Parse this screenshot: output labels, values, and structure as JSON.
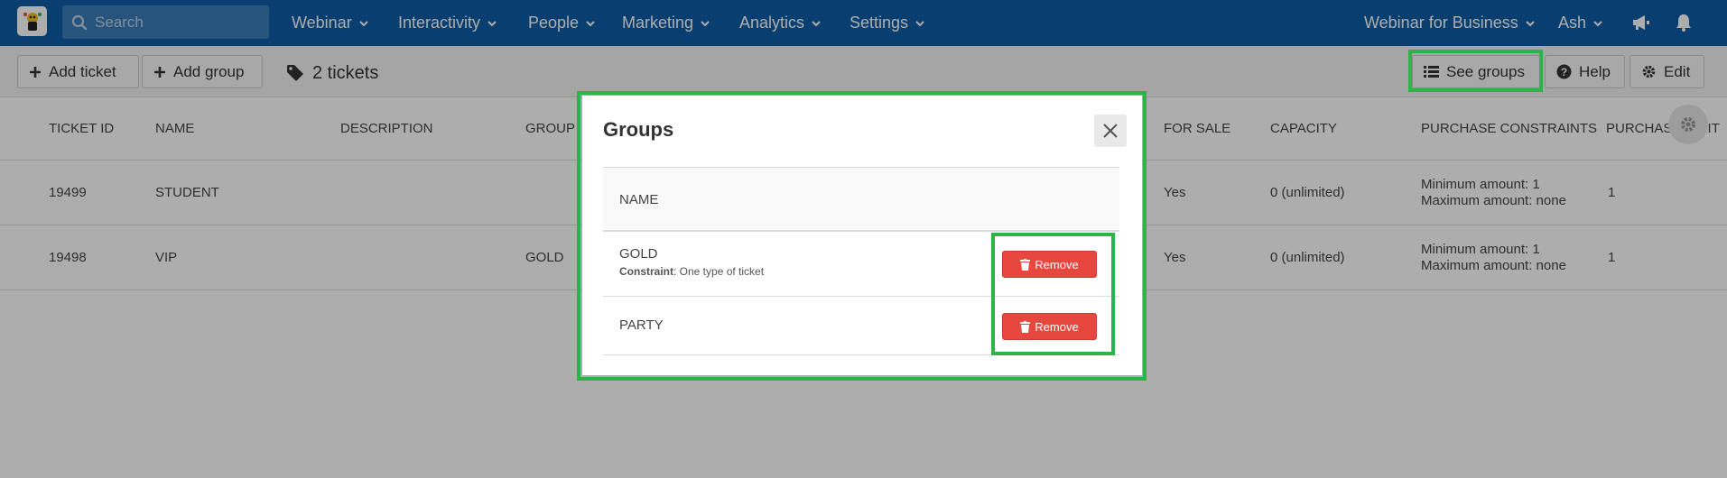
{
  "topnav": {
    "search_placeholder": "Search",
    "menus": [
      "Webinar",
      "Interactivity",
      "People",
      "Marketing",
      "Analytics",
      "Settings"
    ],
    "account": "Webinar for Business",
    "user": "Ash",
    "icons": [
      "megaphone-icon",
      "bell-icon"
    ]
  },
  "toolbar": {
    "add_ticket": "Add ticket",
    "add_group": "Add group",
    "ticket_count": "2 tickets",
    "see_groups": "See groups",
    "help": "Help",
    "edit": "Edit"
  },
  "table": {
    "columns": [
      "TICKET ID",
      "NAME",
      "DESCRIPTION",
      "GROUP",
      "FOR SALE",
      "CAPACITY",
      "PURCHASE CONSTRAINTS",
      "PURCHASE LIMIT"
    ],
    "rows": [
      {
        "id": "19499",
        "name": "STUDENT",
        "description": "",
        "group": "",
        "for_sale": "Yes",
        "capacity": "0 (unlimited)",
        "constraint_min": "Minimum amount: 1",
        "constraint_max": "Maximum amount: none",
        "limit": "1"
      },
      {
        "id": "19498",
        "name": "VIP",
        "description": "",
        "group": "GOLD",
        "for_sale": "Yes",
        "capacity": "0 (unlimited)",
        "constraint_min": "Minimum amount: 1",
        "constraint_max": "Maximum amount: none",
        "limit": "1"
      }
    ]
  },
  "modal": {
    "title": "Groups",
    "column_name": "NAME",
    "groups": [
      {
        "name": "GOLD",
        "constraint_label": "Constraint",
        "constraint_value": ": One type of ticket",
        "remove": "Remove"
      },
      {
        "name": "PARTY",
        "remove": "Remove"
      }
    ]
  },
  "colors": {
    "nav_bg": "#0c5ea6",
    "remove_button": "#e8473e",
    "highlight": "#2cb34a"
  }
}
